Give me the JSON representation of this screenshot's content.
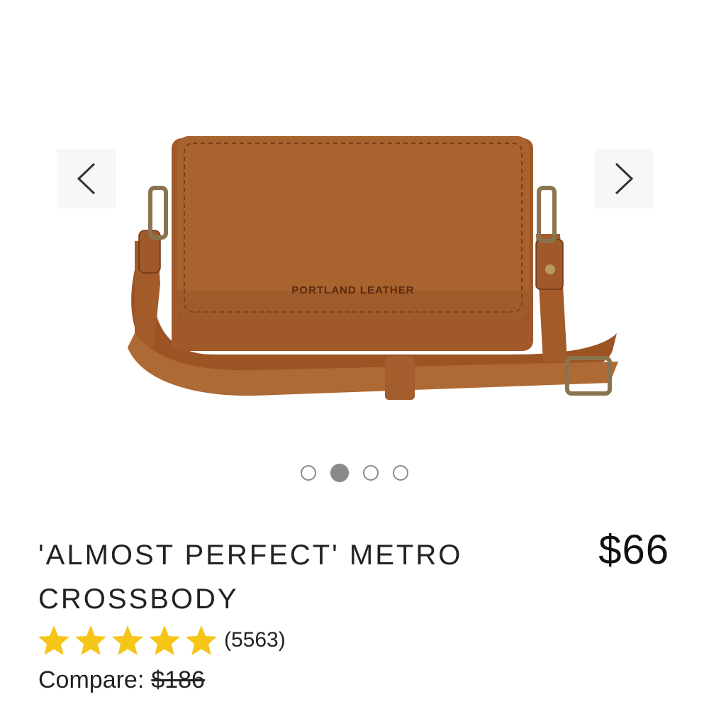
{
  "gallery": {
    "brand_stamp": "PORTLAND LEATHER",
    "slide_count": 4,
    "active_slide": 2
  },
  "product": {
    "title": "'ALMOST PERFECT' METRO CROSSBODY",
    "price": "$66",
    "rating": 5,
    "review_count": "(5563)",
    "compare_label": "Compare:",
    "compare_price": "$186"
  },
  "colors": {
    "star": "#F5C518",
    "leather": "#A85F2E",
    "dot": "#8a8a8a"
  },
  "icons": {
    "prev": "chevron-left-icon",
    "next": "chevron-right-icon",
    "star": "star-icon"
  }
}
